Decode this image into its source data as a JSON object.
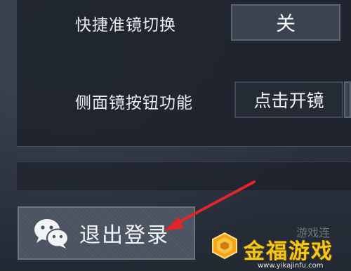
{
  "settings": [
    {
      "label": "快捷准镜切换",
      "value": "关"
    },
    {
      "label": "侧面镜按钮功能",
      "value": "点击开镜"
    }
  ],
  "logout": {
    "label": "退出登录",
    "icon": "wechat-icon"
  },
  "watermark": {
    "faded_text": "游戏连",
    "title": "金福游戏",
    "url": "www.yikajinfu.com",
    "title_color": "#f5c518"
  },
  "annotation": {
    "arrow_color": "#e0262a"
  }
}
